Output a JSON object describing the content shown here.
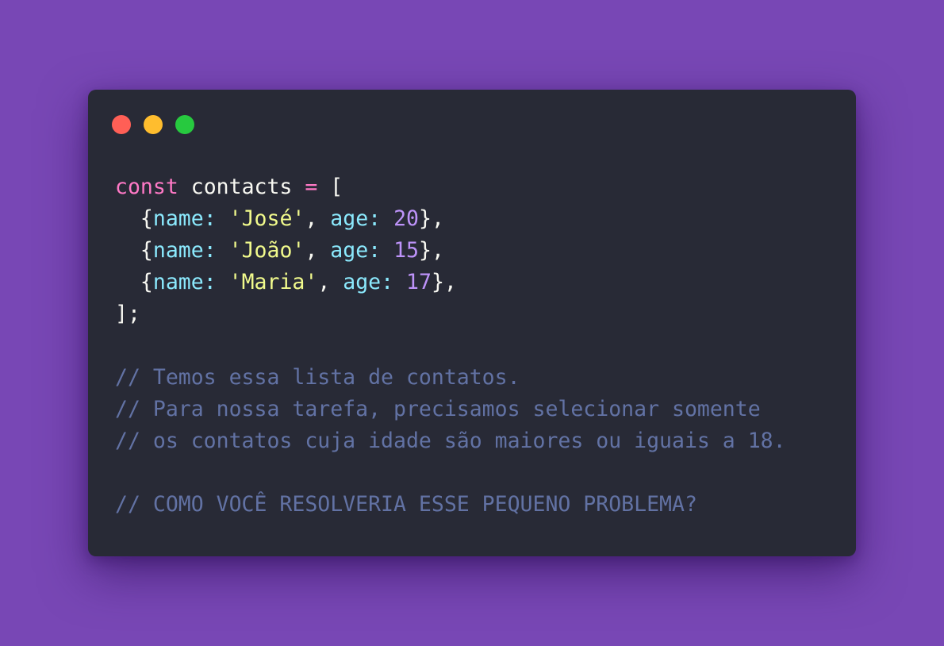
{
  "window": {
    "controls": [
      "close",
      "minimize",
      "maximize"
    ],
    "colors": {
      "background": "#7847b5",
      "window": "#282a36",
      "close": "#ff5f56",
      "minimize": "#ffbd2e",
      "maximize": "#27c93f"
    }
  },
  "code": {
    "keyword": "const",
    "var_name": "contacts",
    "assign": "=",
    "open_bracket": "[",
    "entries": [
      {
        "name": "'José'",
        "age": "20"
      },
      {
        "name": "'João'",
        "age": "15"
      },
      {
        "name": "'Maria'",
        "age": "17"
      }
    ],
    "prop_name": "name:",
    "prop_age": "age:",
    "close": "];",
    "comments": [
      "// Temos essa lista de contatos.",
      "// Para nossa tarefa, precisamos selecionar somente",
      "// os contatos cuja idade são maiores ou iguais a 18.",
      "// COMO VOCÊ RESOLVERIA ESSE PEQUENO PROBLEMA?"
    ]
  }
}
